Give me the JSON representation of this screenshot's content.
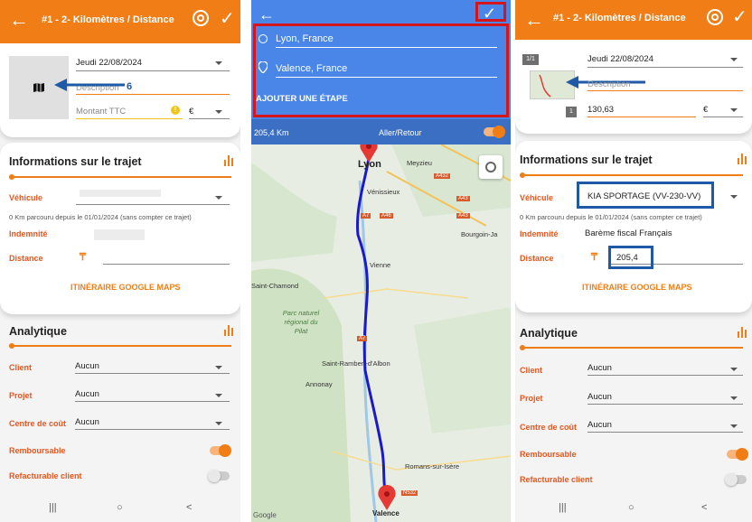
{
  "left": {
    "header": {
      "title": "#1 - 2- Kilomètres / Distance",
      "back_glyph": "←",
      "check_glyph": "✓"
    },
    "date": "Jeudi 22/08/2024",
    "description_placeholder": "Description",
    "annotation_number": "6",
    "amount_placeholder": "Montant TTC",
    "currency": "€",
    "trip": {
      "title": "Informations sur le trajet",
      "vehicle_label": "Véhicule",
      "km_note": "0 Km parcouru depuis le 01/01/2024 (sans compter ce trajet)",
      "indemnity_label": "Indemnité",
      "distance_label": "Distance",
      "maps_link": "ITINÉRAIRE GOOGLE MAPS"
    },
    "analytics": {
      "title": "Analytique",
      "client_label": "Client",
      "client_value": "Aucun",
      "project_label": "Projet",
      "project_value": "Aucun",
      "cost_center_label": "Centre de coût",
      "cost_center_value": "Aucun",
      "refundable_label": "Remboursable",
      "rebillable_label": "Refacturable client"
    },
    "nav": {
      "recent": "|||",
      "home": "○",
      "back": "<"
    }
  },
  "middle": {
    "origin": "Lyon, France",
    "destination": "Valence, France",
    "add_step": "AJOUTER UNE ÉTAPE",
    "distance": "205,4 Km",
    "round_trip_label": "Aller/Retour",
    "map_labels": {
      "lyon": "Lyon",
      "meyzieu": "Meyzieu",
      "venissieux": "Vénissieux",
      "vienne": "Vienne",
      "saint_chamond": "Saint-Chamond",
      "parc": "Parc naturel régional du Pilat",
      "saint_rambert": "Saint-Rambert-d'Albon",
      "annonay": "Annonay",
      "romans": "Romans-sur-Isère",
      "valence": "Valence",
      "bourgoin": "Bourgoin-Ja",
      "google": "Google",
      "roads": {
        "a432": "A432",
        "a43a": "A43",
        "a43b": "A43",
        "a7a": "A7",
        "a46": "A46",
        "a7b": "A7",
        "n532": "N532"
      }
    }
  },
  "right": {
    "header": {
      "title": "#1 - 2- Kilomètres / Distance",
      "back_glyph": "←",
      "check_glyph": "✓"
    },
    "date": "Jeudi 22/08/2024",
    "description_placeholder": "Description",
    "thumb_badge": "1/1",
    "qty_badge": "1",
    "amount": "130,63",
    "currency": "€",
    "trip": {
      "title": "Informations sur le trajet",
      "vehicle_label": "Véhicule",
      "vehicle_value": "KIA SPORTAGE (VV-230-VV)",
      "km_note": "0 Km parcouru depuis le 01/01/2024 (sans compter ce trajet)",
      "indemnity_label": "Indemnité",
      "indemnity_value": "Barème fiscal Français",
      "distance_label": "Distance",
      "distance_value": "205,4",
      "maps_link": "ITINÉRAIRE GOOGLE MAPS"
    },
    "analytics": {
      "title": "Analytique",
      "client_label": "Client",
      "client_value": "Aucun",
      "project_label": "Projet",
      "project_value": "Aucun",
      "cost_center_label": "Centre de coût",
      "cost_center_value": "Aucun",
      "refundable_label": "Remboursable",
      "rebillable_label": "Refacturable client"
    },
    "nav": {
      "recent": "|||",
      "home": "○",
      "back": "<"
    }
  },
  "colors": {
    "accent": "#f07d16",
    "label": "#e8551d",
    "map_panel": "#4a86e8",
    "route": "#1a1ac8",
    "annotation_blue": "#1f5aa6",
    "annotation_red": "#d4151c"
  },
  "icons": [
    "back-arrow-icon",
    "gear-icon",
    "check-icon",
    "map-icon",
    "warning-icon",
    "bar-chart-icon",
    "currency-icon",
    "location-icon",
    "pin-icon",
    "my-location-icon"
  ]
}
